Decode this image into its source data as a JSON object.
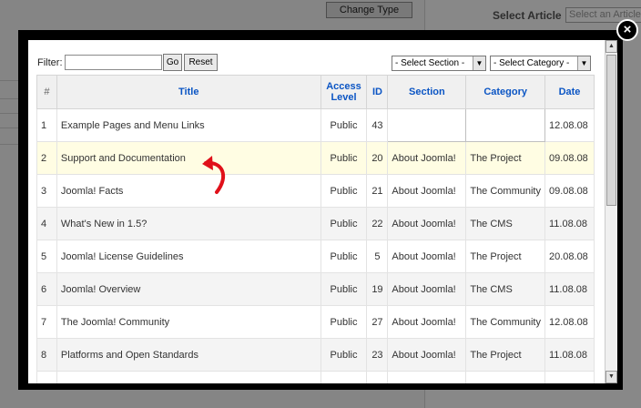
{
  "background": {
    "change_type_label": "Change Type",
    "select_article_label": "Select Article",
    "select_article_placeholder": "Select an Article"
  },
  "modal": {
    "close_glyph": "×",
    "filter": {
      "label": "Filter:",
      "value": "",
      "go_label": "Go",
      "reset_label": "Reset"
    },
    "section_select": {
      "selected": "- Select Section -"
    },
    "category_select": {
      "selected": "- Select Category -"
    },
    "table": {
      "headers": [
        "#",
        "Title",
        "Access Level",
        "ID",
        "Section",
        "Category",
        "Date"
      ],
      "rows": [
        {
          "num": "1",
          "title": "Example Pages and Menu Links",
          "access": "Public",
          "id": "43",
          "section": "",
          "category": "",
          "date": "12.08.08"
        },
        {
          "num": "2",
          "title": "Support and Documentation",
          "access": "Public",
          "id": "20",
          "section": "About Joomla!",
          "category": "The Project",
          "date": "09.08.08"
        },
        {
          "num": "3",
          "title": "Joomla! Facts",
          "access": "Public",
          "id": "21",
          "section": "About Joomla!",
          "category": "The Community",
          "date": "09.08.08"
        },
        {
          "num": "4",
          "title": "What's New in 1.5?",
          "access": "Public",
          "id": "22",
          "section": "About Joomla!",
          "category": "The CMS",
          "date": "11.08.08"
        },
        {
          "num": "5",
          "title": "Joomla! License Guidelines",
          "access": "Public",
          "id": "5",
          "section": "About Joomla!",
          "category": "The Project",
          "date": "20.08.08"
        },
        {
          "num": "6",
          "title": "Joomla! Overview",
          "access": "Public",
          "id": "19",
          "section": "About Joomla!",
          "category": "The CMS",
          "date": "11.08.08"
        },
        {
          "num": "7",
          "title": "The Joomla! Community",
          "access": "Public",
          "id": "27",
          "section": "About Joomla!",
          "category": "The Community",
          "date": "12.08.08"
        },
        {
          "num": "8",
          "title": "Platforms and Open Standards",
          "access": "Public",
          "id": "23",
          "section": "About Joomla!",
          "category": "The Project",
          "date": "11.08.08"
        }
      ]
    },
    "annotation": {
      "icon": "curved-arrow-icon",
      "color": "#e0101a"
    }
  }
}
